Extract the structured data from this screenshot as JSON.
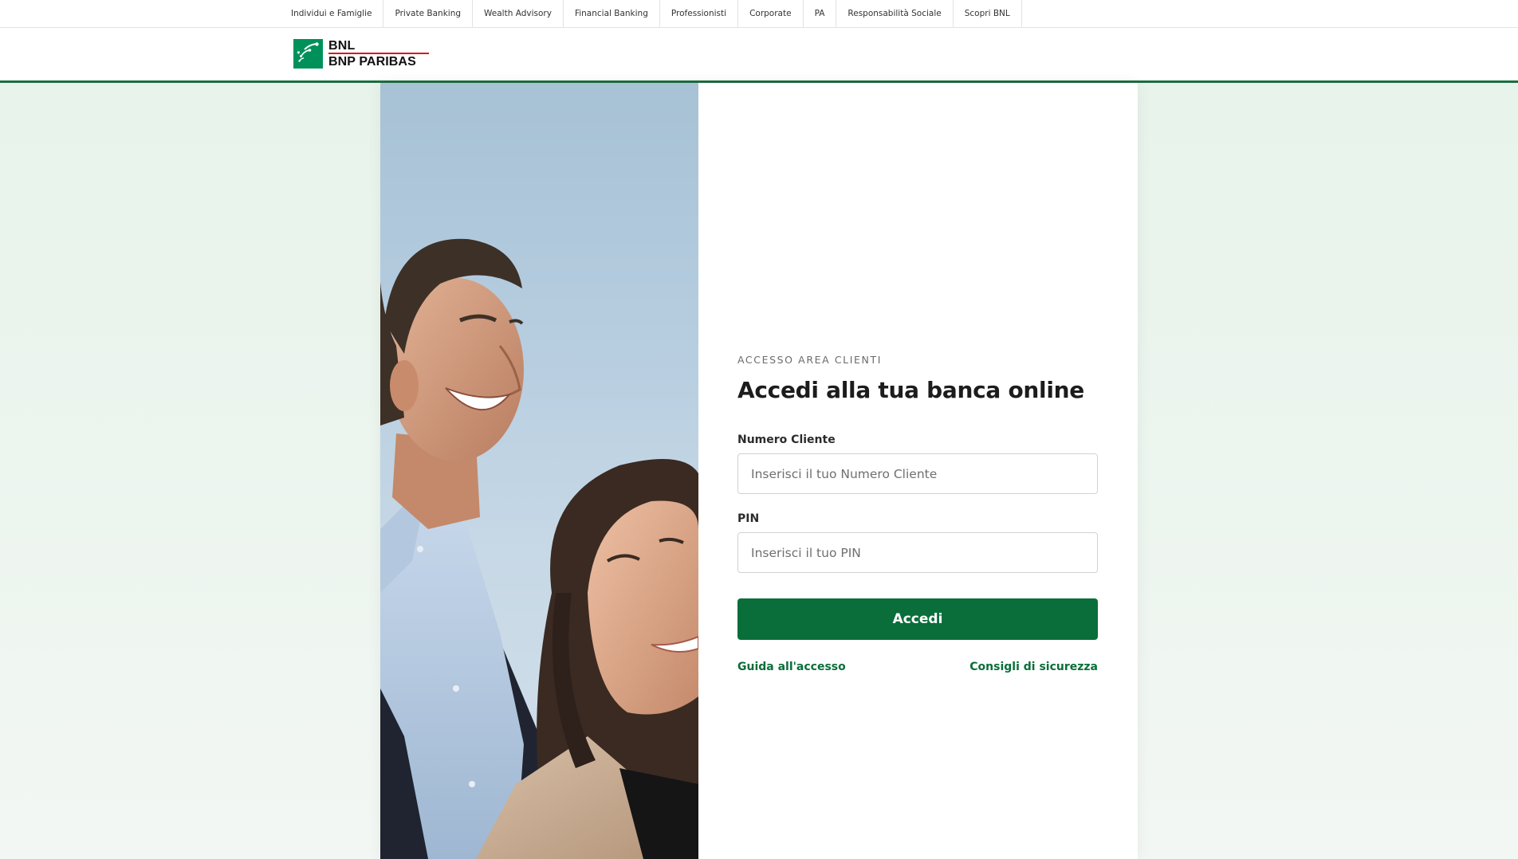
{
  "topnav": {
    "items": [
      "Individui e Famiglie",
      "Private Banking",
      "Wealth Advisory",
      "Financial Banking",
      "Professionisti",
      "Corporate",
      "PA",
      "Responsabilità Sociale",
      "Scopri BNL"
    ]
  },
  "brand": {
    "line1": "BNL",
    "line2": "BNP PARIBAS",
    "logo_icon": "bnp-stars-icon",
    "color": "#00915a",
    "rule_color": "#d71920"
  },
  "login": {
    "eyebrow": "ACCESSO AREA CLIENTI",
    "title": "Accedi alla tua banca online",
    "customer_label": "Numero Cliente",
    "customer_placeholder": "Inserisci il tuo Numero Cliente",
    "pin_label": "PIN",
    "pin_placeholder": "Inserisci il tuo PIN",
    "submit_label": "Accedi",
    "help_link": "Guida all'accesso",
    "security_link": "Consigli di sicurezza"
  },
  "colors": {
    "accent": "#0a6e3a",
    "header_rule": "#1a6e3f",
    "page_bg": "#e6f3ea"
  }
}
